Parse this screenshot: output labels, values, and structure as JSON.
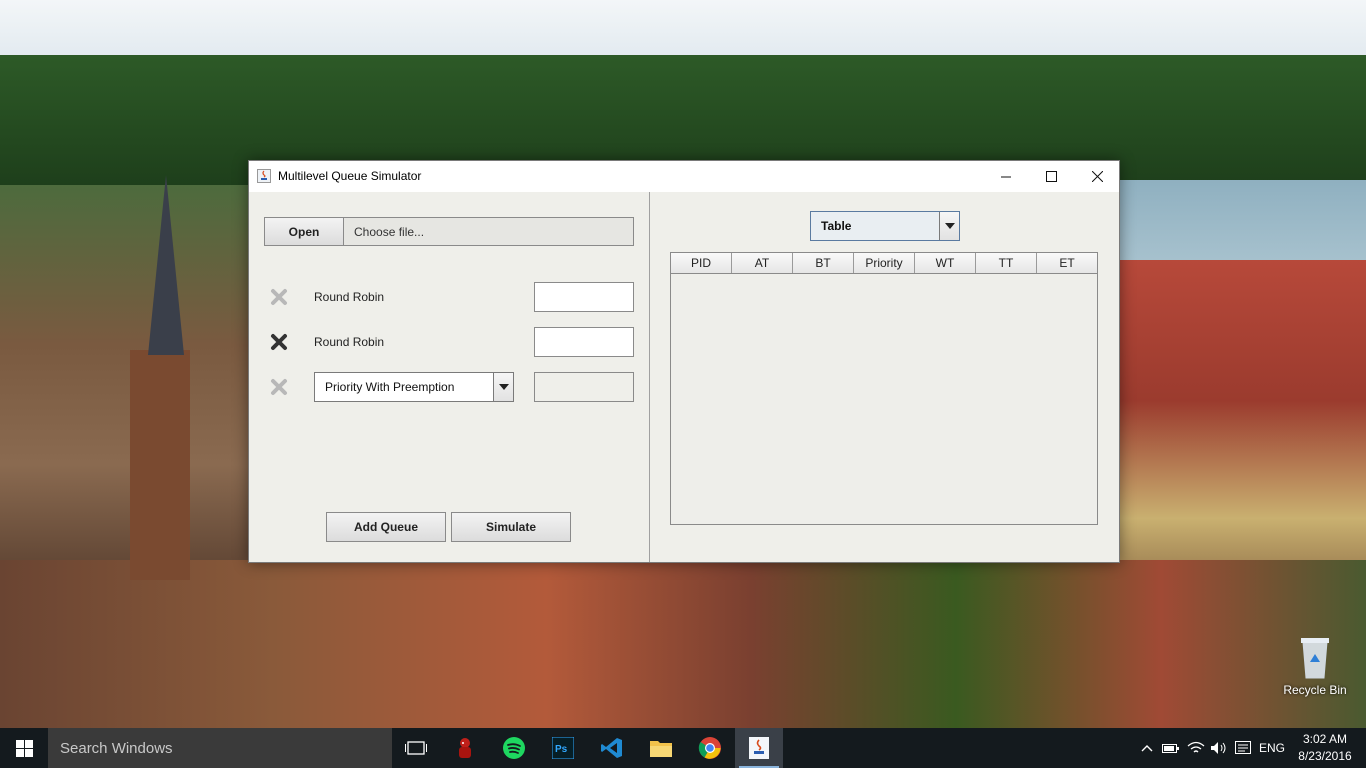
{
  "window": {
    "title": "Multilevel Queue Simulator"
  },
  "file": {
    "open_label": "Open",
    "path_placeholder": "Choose file..."
  },
  "queues": [
    {
      "type": "Round Robin",
      "value": ""
    },
    {
      "type": "Round Robin",
      "value": ""
    },
    {
      "type": "Priority With Preemption",
      "value": ""
    }
  ],
  "actions": {
    "add_queue_label": "Add Queue",
    "simulate_label": "Simulate"
  },
  "view": {
    "selected": "Table"
  },
  "table": {
    "columns": [
      "PID",
      "AT",
      "BT",
      "Priority",
      "WT",
      "TT",
      "ET"
    ],
    "rows": []
  },
  "desktop": {
    "recycle_bin_label": "Recycle Bin"
  },
  "taskbar": {
    "search_placeholder": "Search Windows",
    "language": "ENG",
    "time": "3:02 AM",
    "date": "8/23/2016"
  }
}
